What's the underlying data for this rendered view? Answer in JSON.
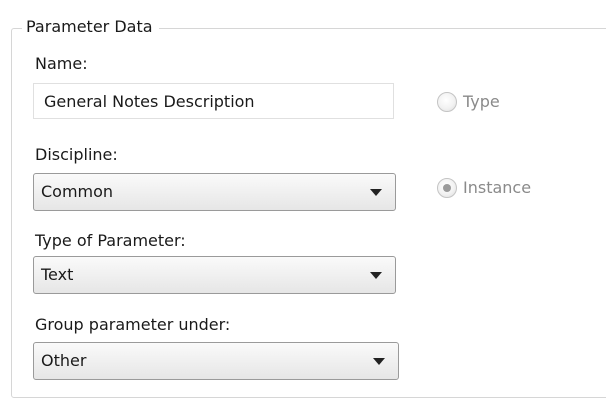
{
  "group": {
    "title": "Parameter Data"
  },
  "name_field": {
    "label": "Name:",
    "value": "General Notes Description"
  },
  "parameter_kind": {
    "options": [
      {
        "label": "Type",
        "selected": false,
        "enabled": false
      },
      {
        "label": "Instance",
        "selected": true,
        "enabled": false
      }
    ]
  },
  "discipline": {
    "label": "Discipline:",
    "value": "Common"
  },
  "type_of_parameter": {
    "label": "Type of Parameter:",
    "value": "Text"
  },
  "group_under": {
    "label": "Group parameter under:",
    "value": "Other"
  },
  "colors": {
    "disabled_text": "#8a8a8a",
    "group_border": "#d6d6d6",
    "dropdown_border": "#9a9a9a"
  }
}
